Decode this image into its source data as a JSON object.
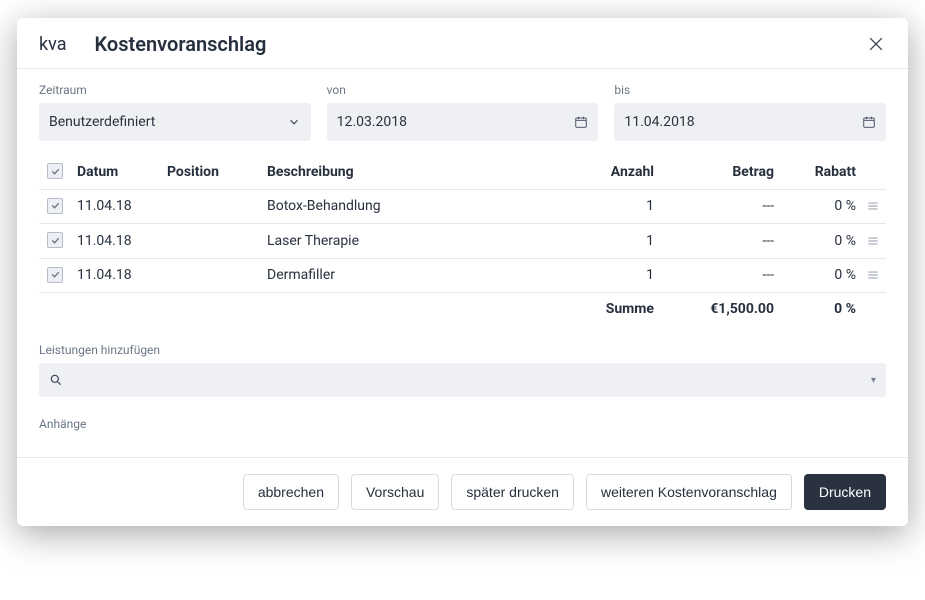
{
  "header": {
    "brand": "kva",
    "title": "Kostenvoranschlag"
  },
  "filters": {
    "period_label": "Zeitraum",
    "period_value": "Benutzerdefiniert",
    "from_label": "von",
    "from_value": "12.03.2018",
    "to_label": "bis",
    "to_value": "11.04.2018"
  },
  "table": {
    "headers": {
      "date": "Datum",
      "position": "Position",
      "description": "Beschreibung",
      "qty": "Anzahl",
      "amount": "Betrag",
      "discount": "Rabatt"
    },
    "rows": [
      {
        "date": "11.04.18",
        "position": "",
        "description": "Botox-Behandlung",
        "qty": "1",
        "amount": "---",
        "discount": "0 %"
      },
      {
        "date": "11.04.18",
        "position": "",
        "description": "Laser Therapie",
        "qty": "1",
        "amount": "---",
        "discount": "0 %"
      },
      {
        "date": "11.04.18",
        "position": "",
        "description": "Dermafiller",
        "qty": "1",
        "amount": "---",
        "discount": "0 %"
      }
    ],
    "summary": {
      "label": "Summe",
      "amount": "€1,500.00",
      "discount": "0 %"
    }
  },
  "add_services_label": "Leistungen hinzufügen",
  "attachments_label": "Anhänge",
  "footer": {
    "cancel": "abbrechen",
    "preview": "Vorschau",
    "print_later": "später drucken",
    "another": "weiteren Kostenvoranschlag",
    "print": "Drucken"
  }
}
